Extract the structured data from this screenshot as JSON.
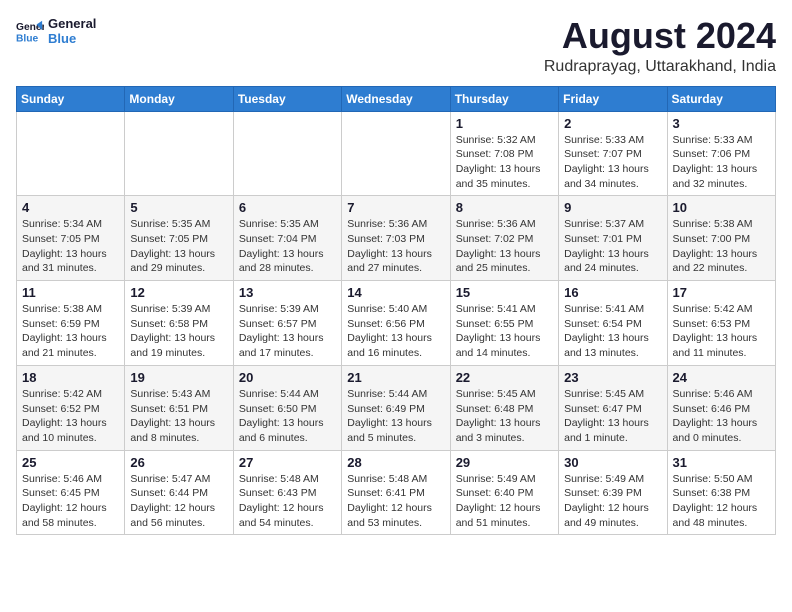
{
  "logo": {
    "line1": "General",
    "line2": "Blue"
  },
  "title": {
    "month_year": "August 2024",
    "location": "Rudraprayag, Uttarakhand, India"
  },
  "days_of_week": [
    "Sunday",
    "Monday",
    "Tuesday",
    "Wednesday",
    "Thursday",
    "Friday",
    "Saturday"
  ],
  "weeks": [
    [
      {
        "day": "",
        "info": ""
      },
      {
        "day": "",
        "info": ""
      },
      {
        "day": "",
        "info": ""
      },
      {
        "day": "",
        "info": ""
      },
      {
        "day": "1",
        "info": "Sunrise: 5:32 AM\nSunset: 7:08 PM\nDaylight: 13 hours\nand 35 minutes."
      },
      {
        "day": "2",
        "info": "Sunrise: 5:33 AM\nSunset: 7:07 PM\nDaylight: 13 hours\nand 34 minutes."
      },
      {
        "day": "3",
        "info": "Sunrise: 5:33 AM\nSunset: 7:06 PM\nDaylight: 13 hours\nand 32 minutes."
      }
    ],
    [
      {
        "day": "4",
        "info": "Sunrise: 5:34 AM\nSunset: 7:05 PM\nDaylight: 13 hours\nand 31 minutes."
      },
      {
        "day": "5",
        "info": "Sunrise: 5:35 AM\nSunset: 7:05 PM\nDaylight: 13 hours\nand 29 minutes."
      },
      {
        "day": "6",
        "info": "Sunrise: 5:35 AM\nSunset: 7:04 PM\nDaylight: 13 hours\nand 28 minutes."
      },
      {
        "day": "7",
        "info": "Sunrise: 5:36 AM\nSunset: 7:03 PM\nDaylight: 13 hours\nand 27 minutes."
      },
      {
        "day": "8",
        "info": "Sunrise: 5:36 AM\nSunset: 7:02 PM\nDaylight: 13 hours\nand 25 minutes."
      },
      {
        "day": "9",
        "info": "Sunrise: 5:37 AM\nSunset: 7:01 PM\nDaylight: 13 hours\nand 24 minutes."
      },
      {
        "day": "10",
        "info": "Sunrise: 5:38 AM\nSunset: 7:00 PM\nDaylight: 13 hours\nand 22 minutes."
      }
    ],
    [
      {
        "day": "11",
        "info": "Sunrise: 5:38 AM\nSunset: 6:59 PM\nDaylight: 13 hours\nand 21 minutes."
      },
      {
        "day": "12",
        "info": "Sunrise: 5:39 AM\nSunset: 6:58 PM\nDaylight: 13 hours\nand 19 minutes."
      },
      {
        "day": "13",
        "info": "Sunrise: 5:39 AM\nSunset: 6:57 PM\nDaylight: 13 hours\nand 17 minutes."
      },
      {
        "day": "14",
        "info": "Sunrise: 5:40 AM\nSunset: 6:56 PM\nDaylight: 13 hours\nand 16 minutes."
      },
      {
        "day": "15",
        "info": "Sunrise: 5:41 AM\nSunset: 6:55 PM\nDaylight: 13 hours\nand 14 minutes."
      },
      {
        "day": "16",
        "info": "Sunrise: 5:41 AM\nSunset: 6:54 PM\nDaylight: 13 hours\nand 13 minutes."
      },
      {
        "day": "17",
        "info": "Sunrise: 5:42 AM\nSunset: 6:53 PM\nDaylight: 13 hours\nand 11 minutes."
      }
    ],
    [
      {
        "day": "18",
        "info": "Sunrise: 5:42 AM\nSunset: 6:52 PM\nDaylight: 13 hours\nand 10 minutes."
      },
      {
        "day": "19",
        "info": "Sunrise: 5:43 AM\nSunset: 6:51 PM\nDaylight: 13 hours\nand 8 minutes."
      },
      {
        "day": "20",
        "info": "Sunrise: 5:44 AM\nSunset: 6:50 PM\nDaylight: 13 hours\nand 6 minutes."
      },
      {
        "day": "21",
        "info": "Sunrise: 5:44 AM\nSunset: 6:49 PM\nDaylight: 13 hours\nand 5 minutes."
      },
      {
        "day": "22",
        "info": "Sunrise: 5:45 AM\nSunset: 6:48 PM\nDaylight: 13 hours\nand 3 minutes."
      },
      {
        "day": "23",
        "info": "Sunrise: 5:45 AM\nSunset: 6:47 PM\nDaylight: 13 hours\nand 1 minute."
      },
      {
        "day": "24",
        "info": "Sunrise: 5:46 AM\nSunset: 6:46 PM\nDaylight: 13 hours\nand 0 minutes."
      }
    ],
    [
      {
        "day": "25",
        "info": "Sunrise: 5:46 AM\nSunset: 6:45 PM\nDaylight: 12 hours\nand 58 minutes."
      },
      {
        "day": "26",
        "info": "Sunrise: 5:47 AM\nSunset: 6:44 PM\nDaylight: 12 hours\nand 56 minutes."
      },
      {
        "day": "27",
        "info": "Sunrise: 5:48 AM\nSunset: 6:43 PM\nDaylight: 12 hours\nand 54 minutes."
      },
      {
        "day": "28",
        "info": "Sunrise: 5:48 AM\nSunset: 6:41 PM\nDaylight: 12 hours\nand 53 minutes."
      },
      {
        "day": "29",
        "info": "Sunrise: 5:49 AM\nSunset: 6:40 PM\nDaylight: 12 hours\nand 51 minutes."
      },
      {
        "day": "30",
        "info": "Sunrise: 5:49 AM\nSunset: 6:39 PM\nDaylight: 12 hours\nand 49 minutes."
      },
      {
        "day": "31",
        "info": "Sunrise: 5:50 AM\nSunset: 6:38 PM\nDaylight: 12 hours\nand 48 minutes."
      }
    ]
  ]
}
